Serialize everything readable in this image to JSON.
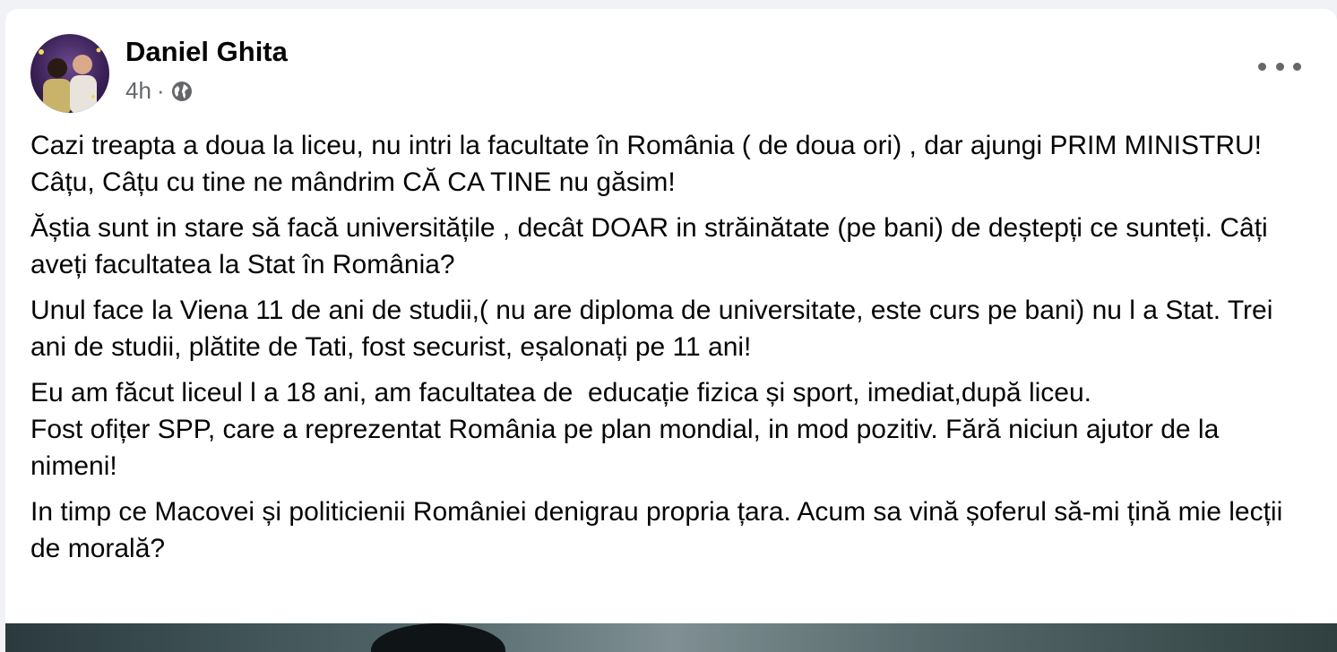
{
  "post": {
    "author": "Daniel Ghita",
    "time": "4h",
    "separator": "·",
    "audience_icon": "globe-icon",
    "more_icon": "more-options-icon",
    "paragraphs": [
      "Cazi treapta a doua la liceu, nu intri la facultate în România ( de doua ori) , dar ajungi PRIM MINISTRU! Câțu, Câțu cu tine ne mândrim CĂ CA TINE nu găsim!",
      "Ăștia sunt in stare să facă universitățile , decât DOAR in străinătate (pe bani) de deștepți ce sunteți. Câți aveți facultatea la Stat în România?",
      "Unul face la Viena 11 de ani de studii,( nu are diploma de universitate, este curs pe bani) nu l a Stat. Trei ani de studii, plătite de Tati, fost securist, eșalonați pe 11 ani!",
      "Eu am făcut liceul l a 18 ani, am facultatea de  educație fizica și sport, imediat,după liceu.\nFost ofițer SPP, care a reprezentat România pe plan mondial, in mod pozitiv. Fără niciun ajutor de la nimeni!",
      "In timp ce Macovei și politicienii României denigrau propria țara. Acum sa vină șoferul să-mi țină mie lecții de morală?"
    ]
  }
}
